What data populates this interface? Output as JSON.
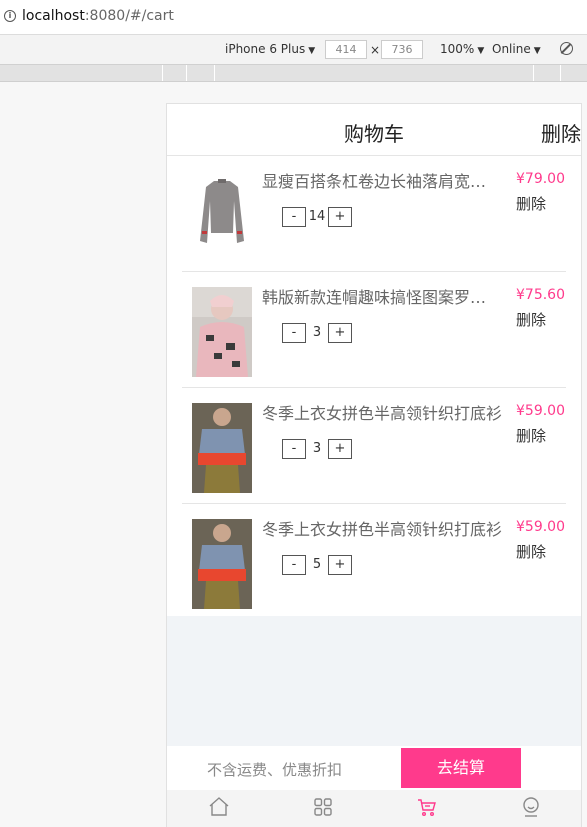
{
  "browser": {
    "url_host": "localhost",
    "url_rest": ":8080/#/cart"
  },
  "device_toolbar": {
    "device": "iPhone 6 Plus",
    "width": "414",
    "times": "×",
    "height": "736",
    "zoom": "100%",
    "network": "Online"
  },
  "app": {
    "header": {
      "title": "购物车",
      "delete_label": "删除"
    },
    "cart_items": [
      {
        "name": "显瘦百搭条杠卷边长袖落肩宽松打底衫",
        "price": "¥79.00",
        "delete_label": "删除",
        "minus": "-",
        "quantity": "14",
        "plus": "+"
      },
      {
        "name": "韩版新款连帽趣味搞怪图案罗纹卫衣",
        "price": "¥75.60",
        "delete_label": "删除",
        "minus": "-",
        "quantity": "3",
        "plus": "+"
      },
      {
        "name": "冬季上衣女拼色半高领针织打底衫",
        "price": "¥59.00",
        "delete_label": "删除",
        "minus": "-",
        "quantity": "3",
        "plus": "+"
      },
      {
        "name": "冬季上衣女拼色半高领针织打底衫",
        "price": "¥59.00",
        "delete_label": "删除",
        "minus": "-",
        "quantity": "5",
        "plus": "+"
      }
    ],
    "checkout": {
      "note": "不含运费、优惠折扣",
      "button": "去结算"
    },
    "tabbar": {
      "items": [
        {
          "icon": "home-icon",
          "active": false
        },
        {
          "icon": "category-icon",
          "active": false
        },
        {
          "icon": "cart-icon",
          "active": true
        },
        {
          "icon": "user-icon",
          "active": false
        }
      ]
    },
    "colors": {
      "accent": "#ff3a8c",
      "text": "#333333",
      "muted": "#888888"
    }
  }
}
